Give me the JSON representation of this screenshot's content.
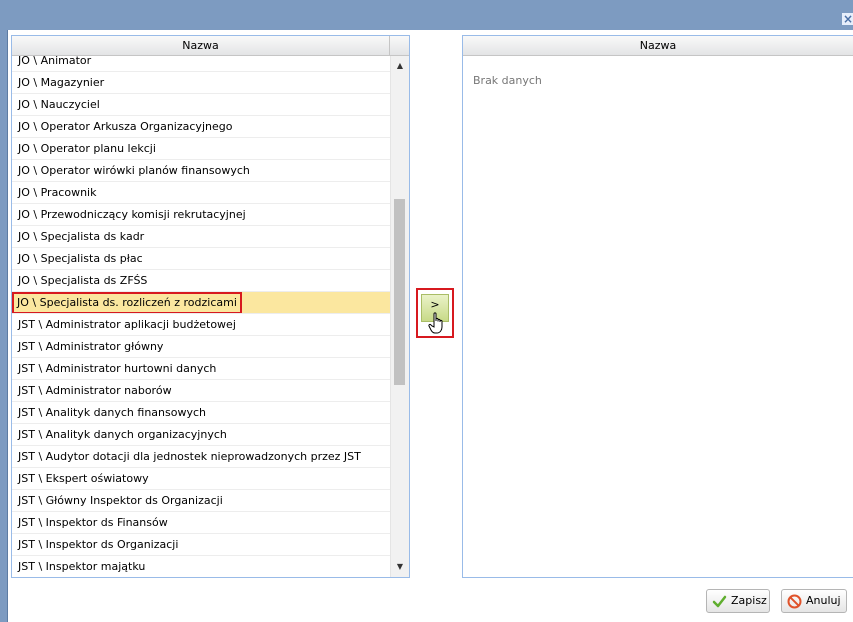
{
  "window": {
    "close_glyph": "×"
  },
  "left_grid": {
    "header": "Nazwa",
    "rows": [
      "JO \\ Animator",
      "JO \\ Magazynier",
      "JO \\ Nauczyciel",
      "JO \\ Operator Arkusza Organizacyjnego",
      "JO \\ Operator planu lekcji",
      "JO \\ Operator wirówki planów finansowych",
      "JO \\ Pracownik",
      "JO \\ Przewodniczący komisji rekrutacyjnej",
      "JO \\ Specjalista ds kadr",
      "JO \\ Specjalista ds płac",
      "JO \\ Specjalista ds ZFŚS",
      "JO \\ Specjalista ds. rozliczeń z rodzicami",
      "JST \\ Administrator aplikacji budżetowej",
      "JST \\ Administrator główny",
      "JST \\ Administrator hurtowni danych",
      "JST \\ Administrator naborów",
      "JST \\ Analityk danych finansowych",
      "JST \\ Analityk danych organizacyjnych",
      "JST \\ Audytor dotacji dla jednostek nieprowadzonych przez JST",
      "JST \\ Ekspert oświatowy",
      "JST \\ Główny Inspektor ds Organizacji",
      "JST \\ Inspektor ds Finansów",
      "JST \\ Inspektor ds Organizacji",
      "JST \\ Inspektor majątku"
    ],
    "selected_index": 11
  },
  "move_right": {
    "label": ">"
  },
  "right_grid": {
    "header": "Nazwa",
    "empty_text": "Brak danych"
  },
  "footer": {
    "save_label": "Zapisz",
    "cancel_label": "Anuluj"
  },
  "colors": {
    "titlebar": "#7d9bc1",
    "selected_row": "#fbe79f",
    "highlight_border": "#d7191f",
    "save_icon": "#5fae2e",
    "cancel_icon": "#e0532b"
  },
  "icons": {
    "close": "close-icon",
    "cursor": "hand-pointer-icon",
    "save": "checkmark-icon",
    "cancel": "no-entry-icon",
    "scroll_up": "triangle-up-icon",
    "scroll_down": "triangle-down-icon"
  }
}
